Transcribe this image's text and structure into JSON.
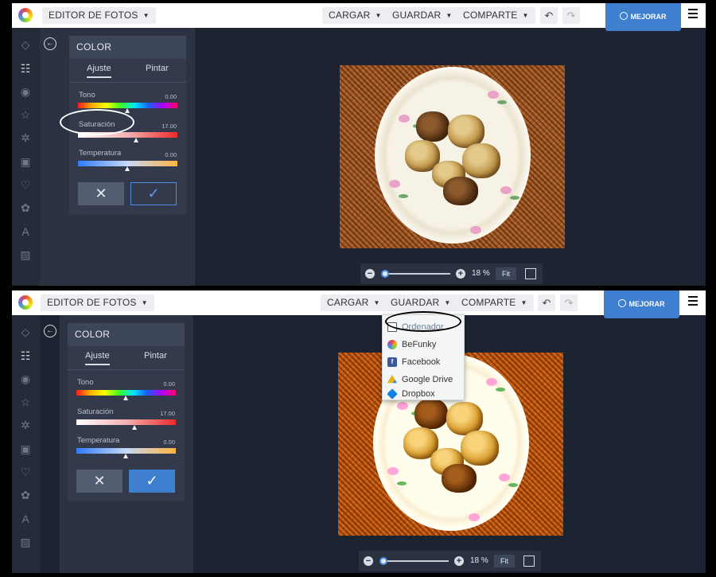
{
  "topbar": {
    "editor_label": "EDITOR DE FOTOS",
    "cargar": "CARGAR",
    "guardar": "GUARDAR",
    "comparte": "COMPARTE",
    "mejorar": "MEJORAR"
  },
  "panel": {
    "title": "COLOR",
    "tabs": [
      "Ajuste",
      "Pintar"
    ],
    "sliders": [
      {
        "label": "Tono",
        "value": "0.00",
        "fraction": 0.5
      },
      {
        "label": "Saturación",
        "value": "17.00",
        "fraction": 0.59
      },
      {
        "label": "Temperatura",
        "value": "0.00",
        "fraction": 0.5
      }
    ],
    "cancel_glyph": "✕",
    "ok_glyph": "✓"
  },
  "zoom": {
    "percent": "18 %",
    "fit": "Fit",
    "fraction": 0.0
  },
  "guardar_menu": {
    "items": [
      {
        "label": "Ordenador",
        "icon": "monitor-icon",
        "color": "#6f7d92"
      },
      {
        "label": "BeFunky",
        "icon": "befunky-icon",
        "color": "#e84b3c"
      },
      {
        "label": "Facebook",
        "icon": "facebook-icon",
        "color": "#3b5998"
      },
      {
        "label": "Google Drive",
        "icon": "google-drive-icon",
        "color": "#f4b400"
      },
      {
        "label": "Dropbox",
        "icon": "dropbox-icon",
        "color": "#0f82e3"
      }
    ]
  },
  "colors": {
    "accent": "#3f7fd0",
    "background": "#1d2330",
    "panel": "#323a4c"
  }
}
